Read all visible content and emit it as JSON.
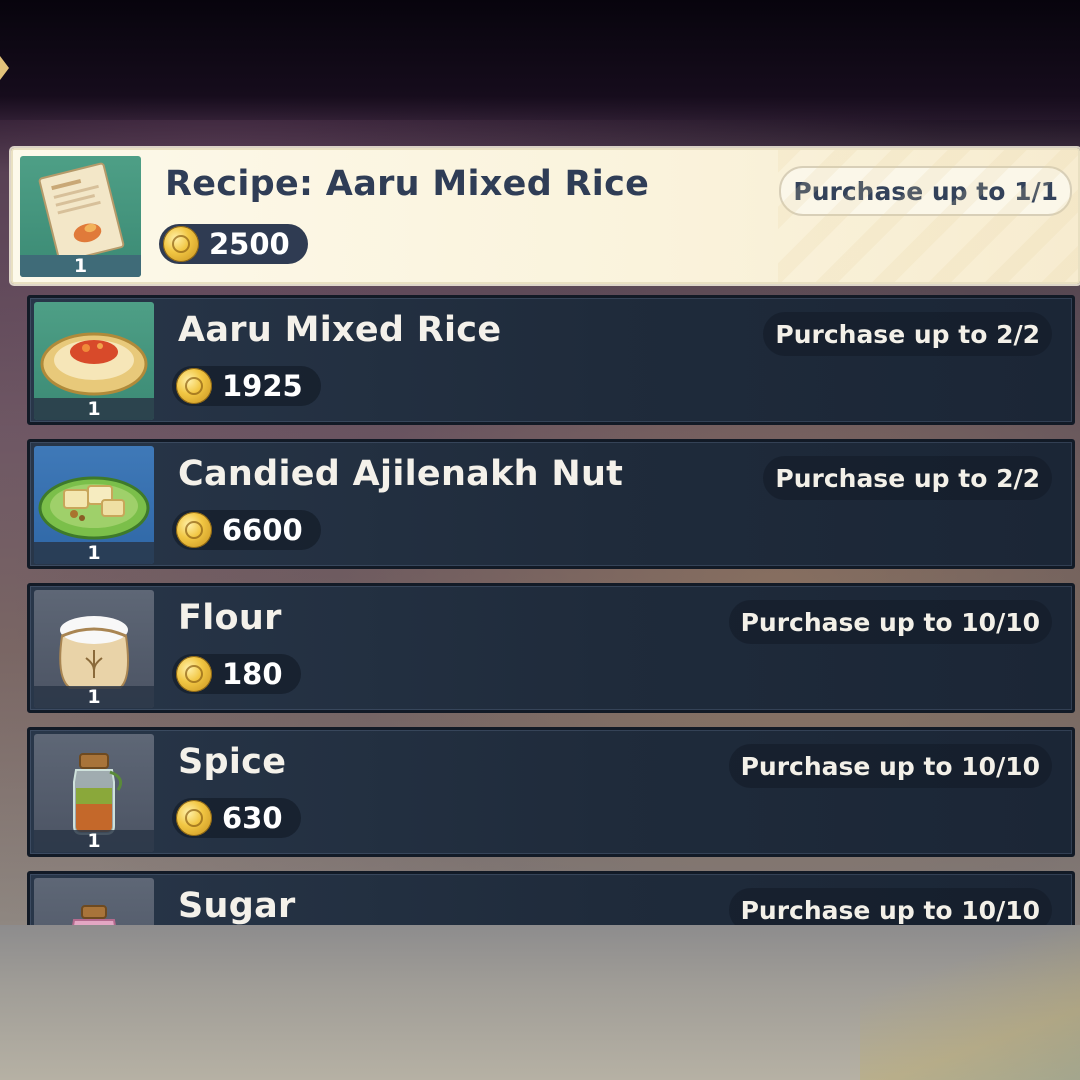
{
  "shop": {
    "items": [
      {
        "name": "Recipe: Aaru Mixed Rice",
        "price": "2500",
        "limit": "Purchase up to 1/1",
        "qty": "1",
        "icon": "recipe-icon"
      },
      {
        "name": "Aaru Mixed Rice",
        "price": "1925",
        "limit": "Purchase up to 2/2",
        "qty": "1",
        "icon": "aaru-mixed-rice-dish-icon"
      },
      {
        "name": "Candied Ajilenakh Nut",
        "price": "6600",
        "limit": "Purchase up to 2/2",
        "qty": "1",
        "icon": "candied-nut-dish-icon"
      },
      {
        "name": "Flour",
        "price": "180",
        "limit": "Purchase up to 10/10",
        "qty": "1",
        "icon": "flour-sack-icon"
      },
      {
        "name": "Spice",
        "price": "630",
        "limit": "Purchase up to 10/10",
        "qty": "1",
        "icon": "spice-jar-icon"
      },
      {
        "name": "Sugar",
        "price": "",
        "limit": "Purchase up to 10/10",
        "qty": "",
        "icon": "sugar-jar-icon"
      }
    ]
  },
  "colors": {
    "selected_bg": "#fdf9ea",
    "row_bg": "#283649",
    "price_coin": "#f2c744"
  }
}
